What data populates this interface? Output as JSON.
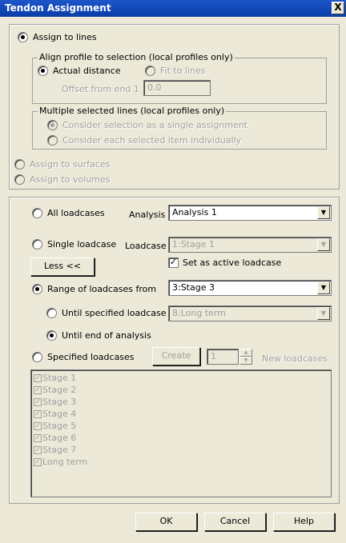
{
  "window": {
    "title": "Tendon Assignment",
    "close_glyph": "X"
  },
  "assign": {
    "to_lines": "Assign to lines",
    "align_group": "Align profile to selection (local profiles only)",
    "actual_distance": "Actual distance",
    "fit_to_lines": "Fit to lines",
    "offset_label": "Offset from end 1",
    "offset_value": "0.0",
    "multiple_group": "Multiple selected lines (local profiles only)",
    "single_assignment": "Consider selection as a single assignment",
    "each_item": "Consider each selected item individually",
    "to_surfaces": "Assign to surfaces",
    "to_volumes": "Assign to volumes"
  },
  "loadcases": {
    "all_loadcases": "All loadcases",
    "analysis_label": "Analysis",
    "analysis_value": "Analysis 1",
    "single_loadcase": "Single loadcase",
    "loadcase_label": "Loadcase",
    "loadcase_value": "1:Stage 1",
    "less_button": "Less <<",
    "set_active": "Set as active loadcase",
    "range_from": "Range of loadcases from",
    "range_value": "3:Stage 3",
    "until_specified": "Until specified loadcase",
    "until_value": "8:Long term",
    "until_end": "Until end of analysis",
    "specified": "Specified loadcases",
    "create_button": "Create",
    "new_count": "1",
    "new_loadcases": "New loadcases",
    "list": [
      "Stage 1",
      "Stage 2",
      "Stage 3",
      "Stage 4",
      "Stage 5",
      "Stage 6",
      "Stage 7",
      "Long term"
    ]
  },
  "footer": {
    "ok": "OK",
    "cancel": "Cancel",
    "help": "Help"
  },
  "colors": {
    "title_bar": "#0a3da8",
    "dialog_bg": "#ece9d8",
    "disabled_text": "#a0a0a0"
  },
  "icons": {
    "close": "close-icon",
    "dropdown": "chevron-down-icon",
    "check": "check-icon"
  }
}
